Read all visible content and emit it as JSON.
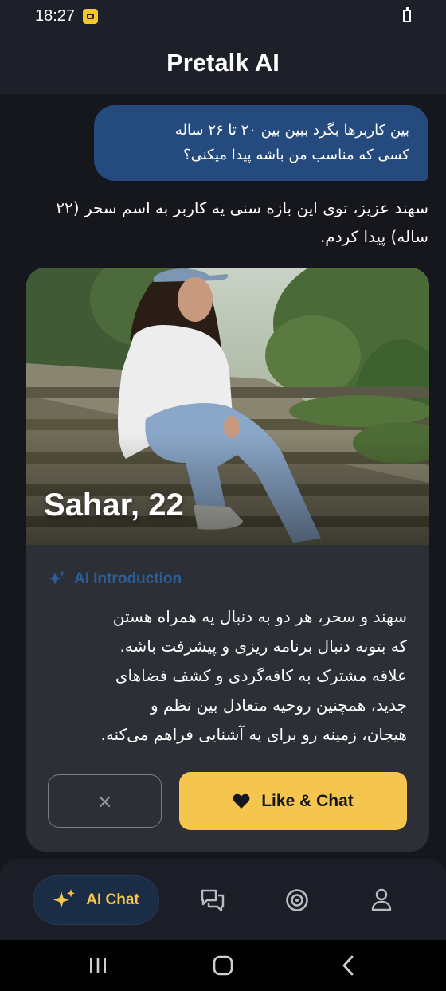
{
  "status_bar": {
    "time": "18:27"
  },
  "header": {
    "title": "Pretalk AI"
  },
  "chat": {
    "user_message_lines": [
      "بین کاربرها بگرد ببین بین ۲۰ تا ۲۶ ساله",
      "کسی که مناسب من باشه پیدا میکنی؟"
    ],
    "ai_message_lines": [
      "سهند عزیز، توی این بازه سنی یه کاربر به اسم سحر (۲۲",
      "ساله) پیدا کردم."
    ]
  },
  "profile_card": {
    "name_age": "Sahar, 22",
    "intro_label": "AI Introduction",
    "intro_lines": [
      "سهند و سحر، هر دو به دنبال یه همراه هستن",
      "که بتونه دنبال برنامه ریزی و پیشرفت باشه.",
      "علاقه مشترک به کافه‌گردی و کشف فضاهای",
      "جدید، همچنین روحیه متعادل بین نظم و",
      "هیجان، زمینه رو برای یه آشنایی فراهم می‌کنه."
    ],
    "pass_label": "×",
    "like_label": "Like & Chat"
  },
  "bottom_nav": {
    "active_label": "AI Chat",
    "items": [
      "sparkle-icon",
      "chat-bubbles-icon",
      "target-icon",
      "person-icon"
    ]
  },
  "colors": {
    "background": "#15171d",
    "header": "#1d2029",
    "user_bubble": "#254a7d",
    "card": "#2c2f36",
    "accent_yellow": "#f5c64f",
    "accent_blue": "#2e5d97"
  }
}
